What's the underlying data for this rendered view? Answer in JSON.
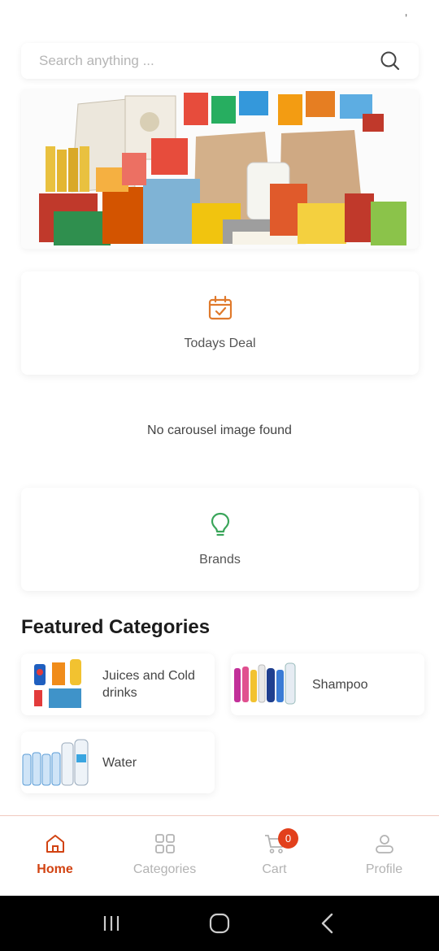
{
  "status": {
    "mark": "’"
  },
  "search": {
    "placeholder": "Search anything ..."
  },
  "banner": {
    "icon": "grocery-banner-image"
  },
  "todays_deal": {
    "label": "Todays Deal",
    "icon": "calendar-check-icon",
    "color": "#e07a2c"
  },
  "carousel": {
    "message": "No carousel image found"
  },
  "brands": {
    "label": "Brands",
    "icon": "lightbulb-icon",
    "color": "#3aa55a"
  },
  "featured": {
    "title": "Featured Categories",
    "categories": [
      {
        "name": "Juices and Cold drinks"
      },
      {
        "name": "Shampoo"
      },
      {
        "name": "Water"
      }
    ]
  },
  "nav": {
    "accent": "#d24312",
    "items": [
      {
        "label": "Home",
        "icon": "home-icon",
        "active": true
      },
      {
        "label": "Categories",
        "icon": "grid-icon",
        "active": false
      },
      {
        "label": "Cart",
        "icon": "cart-icon",
        "active": false,
        "badge": "0"
      },
      {
        "label": "Profile",
        "icon": "profile-icon",
        "active": false
      }
    ]
  },
  "system_nav": {
    "icons": [
      "recents-icon",
      "home-button-icon",
      "back-icon"
    ]
  }
}
